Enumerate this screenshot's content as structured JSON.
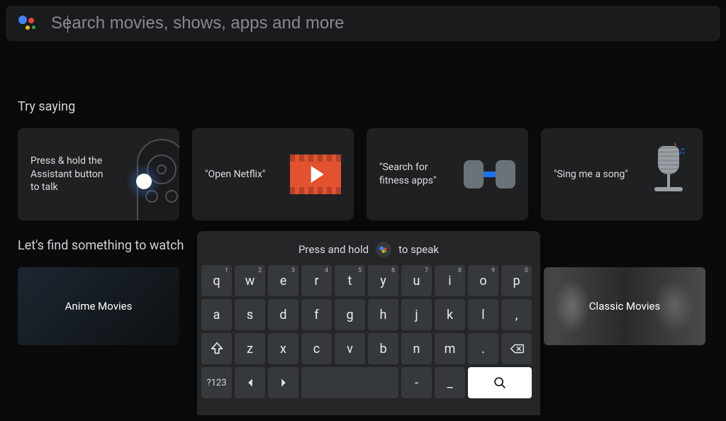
{
  "search": {
    "placeholder": "Search movies, shows, apps and more",
    "value": ""
  },
  "sections": {
    "try_saying_title": "Try saying",
    "find_title": "Let's find something to watch"
  },
  "try_saying": [
    {
      "text": "Press & hold the Assistant button to talk",
      "icon": "remote"
    },
    {
      "text": "\"Open Netflix\"",
      "icon": "film"
    },
    {
      "text": "\"Search for fitness apps\"",
      "icon": "dumbbell"
    },
    {
      "text": "\"Sing me a song\"",
      "icon": "microphone"
    }
  ],
  "find_tiles": [
    {
      "label": "Anime Movies"
    },
    {
      "label": "Classic Movies"
    }
  ],
  "keyboard": {
    "hint_left": "Press and hold",
    "hint_right": "to speak",
    "rows": [
      [
        {
          "label": "q",
          "sup": "1"
        },
        {
          "label": "w",
          "sup": "2"
        },
        {
          "label": "e",
          "sup": "3"
        },
        {
          "label": "r",
          "sup": "4"
        },
        {
          "label": "t",
          "sup": "5"
        },
        {
          "label": "y",
          "sup": "6"
        },
        {
          "label": "u",
          "sup": "7"
        },
        {
          "label": "i",
          "sup": "8"
        },
        {
          "label": "o",
          "sup": "9"
        },
        {
          "label": "p",
          "sup": "0"
        }
      ],
      [
        {
          "label": "a"
        },
        {
          "label": "s"
        },
        {
          "label": "d"
        },
        {
          "label": "f"
        },
        {
          "label": "g"
        },
        {
          "label": "h"
        },
        {
          "label": "j"
        },
        {
          "label": "k"
        },
        {
          "label": "l"
        },
        {
          "label": ","
        }
      ],
      [
        {
          "label": "shift",
          "icon": true
        },
        {
          "label": "z"
        },
        {
          "label": "x"
        },
        {
          "label": "c"
        },
        {
          "label": "v"
        },
        {
          "label": "b"
        },
        {
          "label": "n"
        },
        {
          "label": "m"
        },
        {
          "label": "."
        },
        {
          "label": "backspace",
          "icon": true
        }
      ],
      [
        {
          "label": "?123",
          "sym": true
        },
        {
          "label": "left-arrow",
          "icon": true
        },
        {
          "label": "right-arrow",
          "icon": true
        },
        {
          "label": " ",
          "space": true
        },
        {
          "label": "-"
        },
        {
          "label": "_"
        },
        {
          "label": "search",
          "icon": true,
          "white": true
        }
      ]
    ]
  }
}
